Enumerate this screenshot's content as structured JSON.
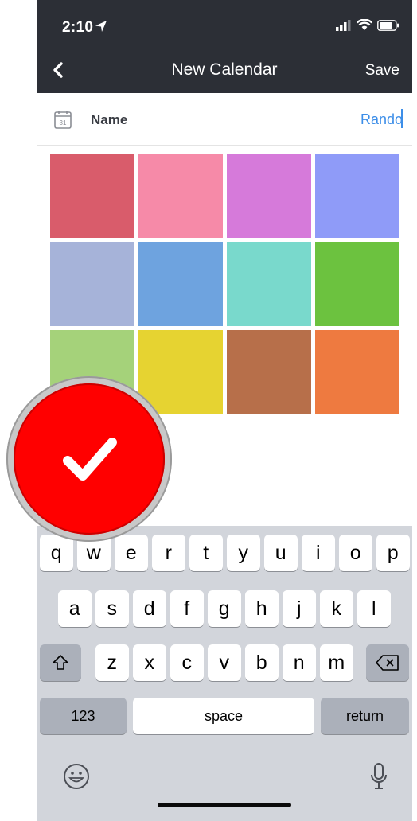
{
  "status": {
    "time": "2:10"
  },
  "nav": {
    "title": "New Calendar",
    "save_label": "Save"
  },
  "form": {
    "name_label": "Name",
    "name_value": "Rando"
  },
  "colors": [
    "#d95c6b",
    "#f68aa8",
    "#d67ada",
    "#8f9bf8",
    "#a6b3d9",
    "#6ea3df",
    "#79d9cc",
    "#6cc23f",
    "#a5d27a",
    "#e6d331",
    "#b76f4a",
    "#ee7a40"
  ],
  "keyboard": {
    "row1": [
      "q",
      "w",
      "e",
      "r",
      "t",
      "y",
      "u",
      "i",
      "o",
      "p"
    ],
    "row2": [
      "a",
      "s",
      "d",
      "f",
      "g",
      "h",
      "j",
      "k",
      "l"
    ],
    "row3": [
      "z",
      "x",
      "c",
      "v",
      "b",
      "n",
      "m"
    ],
    "numbers_label": "123",
    "space_label": "space",
    "return_label": "return"
  }
}
